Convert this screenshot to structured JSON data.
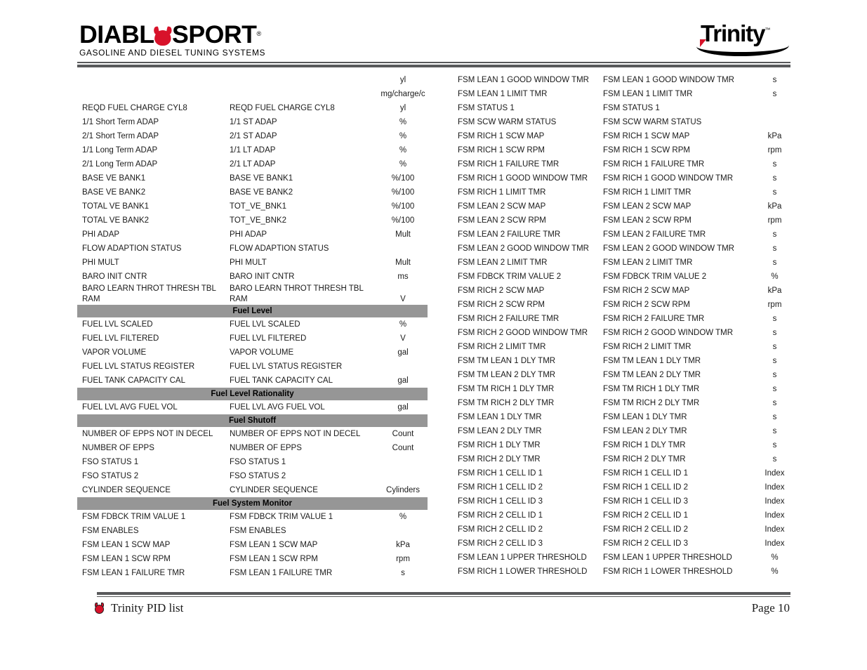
{
  "header": {
    "brand_logo": {
      "word_part1": "DIABL",
      "word_part2": "SPORT",
      "registered_mark": "®",
      "tagline": "GASOLINE AND DIESEL TUNING SYSTEMS",
      "devil_color": "#d8122a"
    },
    "product_logo": {
      "word": "Trinity",
      "tm_mark": "™",
      "accent_color": "#d8122a"
    },
    "rule_color": "#58595b"
  },
  "section_bar_color": "#969696",
  "left_column": {
    "leading_units": [
      "yl",
      "mg/charge/c"
    ],
    "rows": [
      {
        "type": "data",
        "name": "REQD FUEL CHARGE CYL8",
        "abbr": "REQD FUEL CHARGE CYL8",
        "unit": "yl"
      },
      {
        "type": "data",
        "name": "1/1 Short Term ADAP",
        "abbr": "1/1 ST ADAP",
        "unit": "%"
      },
      {
        "type": "data",
        "name": "2/1 Short Term ADAP",
        "abbr": "2/1 ST ADAP",
        "unit": "%"
      },
      {
        "type": "data",
        "name": "1/1 Long Term ADAP",
        "abbr": "1/1 LT ADAP",
        "unit": "%"
      },
      {
        "type": "data",
        "name": "2/1 Long Term ADAP",
        "abbr": "2/1 LT ADAP",
        "unit": "%"
      },
      {
        "type": "data",
        "name": "BASE VE BANK1",
        "abbr": "BASE VE BANK1",
        "unit": "%/100"
      },
      {
        "type": "data",
        "name": "BASE VE BANK2",
        "abbr": "BASE VE BANK2",
        "unit": "%/100"
      },
      {
        "type": "data",
        "name": "TOTAL VE BANK1",
        "abbr": "TOT_VE_BNK1",
        "unit": "%/100"
      },
      {
        "type": "data",
        "name": "TOTAL VE BANK2",
        "abbr": "TOT_VE_BNK2",
        "unit": "%/100"
      },
      {
        "type": "data",
        "name": "PHI ADAP",
        "abbr": "PHI ADAP",
        "unit": "Mult"
      },
      {
        "type": "data",
        "name": "FLOW ADAPTION STATUS",
        "abbr": "FLOW ADAPTION STATUS",
        "unit": ""
      },
      {
        "type": "data",
        "name": "PHI MULT",
        "abbr": "PHI MULT",
        "unit": "Mult"
      },
      {
        "type": "data",
        "name": "BARO INIT CNTR",
        "abbr": "BARO INIT CNTR",
        "unit": "ms"
      },
      {
        "type": "wrap",
        "name_l1": "BARO LEARN THROT THRESH TBL",
        "name_l2": "RAM",
        "abbr_l1": "BARO LEARN THROT THRESH TBL",
        "abbr_l2": "RAM",
        "unit": "V"
      },
      {
        "type": "section",
        "label": "Fuel Level"
      },
      {
        "type": "data",
        "name": "FUEL LVL SCALED",
        "abbr": "FUEL LVL SCALED",
        "unit": "%"
      },
      {
        "type": "data",
        "name": "FUEL LVL FILTERED",
        "abbr": "FUEL LVL FILTERED",
        "unit": "V"
      },
      {
        "type": "data",
        "name": "VAPOR VOLUME",
        "abbr": "VAPOR VOLUME",
        "unit": "gal"
      },
      {
        "type": "data",
        "name": "FUEL LVL STATUS REGISTER",
        "abbr": "FUEL LVL STATUS REGISTER",
        "unit": ""
      },
      {
        "type": "data",
        "name": "FUEL TANK CAPACITY CAL",
        "abbr": "FUEL TANK CAPACITY CAL",
        "unit": "gal"
      },
      {
        "type": "section",
        "label": "Fuel Level Rationality"
      },
      {
        "type": "data",
        "name": "FUEL LVL AVG FUEL VOL",
        "abbr": "FUEL LVL AVG FUEL VOL",
        "unit": "gal"
      },
      {
        "type": "section",
        "label": "Fuel Shutoff"
      },
      {
        "type": "data",
        "name": "NUMBER OF EPPS NOT IN DECEL",
        "abbr": "NUMBER OF EPPS NOT IN DECEL",
        "unit": "Count"
      },
      {
        "type": "data",
        "name": "NUMBER OF EPPS",
        "abbr": "NUMBER OF EPPS",
        "unit": "Count"
      },
      {
        "type": "data",
        "name": "FSO STATUS 1",
        "abbr": "FSO STATUS 1",
        "unit": ""
      },
      {
        "type": "data",
        "name": "FSO STATUS 2",
        "abbr": "FSO STATUS 2",
        "unit": ""
      },
      {
        "type": "data",
        "name": "CYLINDER SEQUENCE",
        "abbr": "CYLINDER SEQUENCE",
        "unit": "Cylinders"
      },
      {
        "type": "section",
        "label": "Fuel System Monitor"
      },
      {
        "type": "data",
        "name": "FSM FDBCK TRIM VALUE 1",
        "abbr": "FSM FDBCK TRIM VALUE 1",
        "unit": "%"
      },
      {
        "type": "data",
        "name": "FSM ENABLES",
        "abbr": "FSM ENABLES",
        "unit": ""
      },
      {
        "type": "data",
        "name": "FSM LEAN 1 SCW MAP",
        "abbr": "FSM LEAN 1 SCW MAP",
        "unit": "kPa"
      },
      {
        "type": "data",
        "name": "FSM LEAN 1 SCW RPM",
        "abbr": "FSM LEAN 1 SCW RPM",
        "unit": "rpm"
      },
      {
        "type": "data",
        "name": "FSM LEAN 1 FAILURE TMR",
        "abbr": "FSM LEAN 1 FAILURE TMR",
        "unit": "s"
      }
    ]
  },
  "right_column": {
    "rows": [
      {
        "type": "data",
        "name": "FSM LEAN 1 GOOD WINDOW TMR",
        "abbr": "FSM LEAN 1 GOOD WINDOW TMR",
        "unit": "s"
      },
      {
        "type": "data",
        "name": "FSM LEAN 1 LIMIT TMR",
        "abbr": "FSM LEAN 1 LIMIT TMR",
        "unit": "s"
      },
      {
        "type": "data",
        "name": "FSM STATUS 1",
        "abbr": "FSM STATUS 1",
        "unit": ""
      },
      {
        "type": "data",
        "name": "FSM SCW WARM STATUS",
        "abbr": "FSM SCW WARM STATUS",
        "unit": ""
      },
      {
        "type": "data",
        "name": "FSM RICH 1 SCW MAP",
        "abbr": "FSM RICH 1 SCW MAP",
        "unit": "kPa"
      },
      {
        "type": "data",
        "name": "FSM RICH 1 SCW RPM",
        "abbr": "FSM RICH 1 SCW RPM",
        "unit": "rpm"
      },
      {
        "type": "data",
        "name": "FSM RICH 1 FAILURE TMR",
        "abbr": "FSM RICH 1 FAILURE TMR",
        "unit": "s"
      },
      {
        "type": "data",
        "name": "FSM RICH 1 GOOD WINDOW TMR",
        "abbr": "FSM RICH 1 GOOD WINDOW TMR",
        "unit": "s"
      },
      {
        "type": "data",
        "name": "FSM RICH 1 LIMIT TMR",
        "abbr": "FSM RICH 1 LIMIT TMR",
        "unit": "s"
      },
      {
        "type": "data",
        "name": "FSM LEAN 2 SCW MAP",
        "abbr": "FSM LEAN 2 SCW MAP",
        "unit": "kPa"
      },
      {
        "type": "data",
        "name": "FSM LEAN 2 SCW RPM",
        "abbr": "FSM LEAN 2 SCW RPM",
        "unit": "rpm"
      },
      {
        "type": "data",
        "name": "FSM LEAN 2 FAILURE TMR",
        "abbr": "FSM LEAN 2 FAILURE TMR",
        "unit": "s"
      },
      {
        "type": "data",
        "name": "FSM LEAN 2 GOOD WINDOW TMR",
        "abbr": "FSM LEAN 2 GOOD WINDOW TMR",
        "unit": "s"
      },
      {
        "type": "data",
        "name": "FSM LEAN 2 LIMIT TMR",
        "abbr": "FSM LEAN 2 LIMIT TMR",
        "unit": "s"
      },
      {
        "type": "data",
        "name": "FSM FDBCK TRIM VALUE 2",
        "abbr": "FSM FDBCK TRIM VALUE 2",
        "unit": "%"
      },
      {
        "type": "data",
        "name": "FSM RICH 2 SCW MAP",
        "abbr": "FSM RICH 2 SCW MAP",
        "unit": "kPa"
      },
      {
        "type": "data",
        "name": "FSM RICH 2 SCW RPM",
        "abbr": "FSM RICH 2 SCW RPM",
        "unit": "rpm"
      },
      {
        "type": "data",
        "name": "FSM RICH 2 FAILURE TMR",
        "abbr": "FSM RICH 2 FAILURE TMR",
        "unit": "s"
      },
      {
        "type": "data",
        "name": "FSM RICH 2 GOOD WINDOW TMR",
        "abbr": "FSM RICH 2 GOOD WINDOW TMR",
        "unit": "s"
      },
      {
        "type": "data",
        "name": "FSM RICH 2 LIMIT TMR",
        "abbr": "FSM RICH 2 LIMIT TMR",
        "unit": "s"
      },
      {
        "type": "data",
        "name": "FSM TM LEAN 1 DLY TMR",
        "abbr": "FSM TM LEAN 1 DLY TMR",
        "unit": "s"
      },
      {
        "type": "data",
        "name": "FSM TM LEAN 2 DLY TMR",
        "abbr": "FSM TM LEAN 2 DLY TMR",
        "unit": "s"
      },
      {
        "type": "data",
        "name": "FSM TM RICH 1 DLY TMR",
        "abbr": "FSM TM RICH 1 DLY TMR",
        "unit": "s"
      },
      {
        "type": "data",
        "name": "FSM TM RICH 2 DLY TMR",
        "abbr": "FSM TM RICH 2 DLY TMR",
        "unit": "s"
      },
      {
        "type": "data",
        "name": "FSM LEAN 1 DLY TMR",
        "abbr": "FSM LEAN 1 DLY TMR",
        "unit": "s"
      },
      {
        "type": "data",
        "name": "FSM LEAN 2 DLY TMR",
        "abbr": "FSM LEAN 2 DLY TMR",
        "unit": "s"
      },
      {
        "type": "data",
        "name": "FSM RICH 1 DLY TMR",
        "abbr": "FSM RICH 1 DLY TMR",
        "unit": "s"
      },
      {
        "type": "data",
        "name": "FSM RICH 2 DLY TMR",
        "abbr": "FSM RICH 2 DLY TMR",
        "unit": "s"
      },
      {
        "type": "data",
        "name": "FSM RICH 1 CELL ID 1",
        "abbr": "FSM RICH 1 CELL ID 1",
        "unit": "Index"
      },
      {
        "type": "data",
        "name": "FSM RICH 1 CELL ID 2",
        "abbr": "FSM RICH 1 CELL ID 2",
        "unit": "Index"
      },
      {
        "type": "data",
        "name": "FSM RICH 1 CELL ID 3",
        "abbr": "FSM RICH 1 CELL ID 3",
        "unit": "Index"
      },
      {
        "type": "data",
        "name": "FSM RICH 2 CELL ID 1",
        "abbr": "FSM RICH 2 CELL ID 1",
        "unit": "Index"
      },
      {
        "type": "data",
        "name": "FSM RICH 2 CELL ID 2",
        "abbr": "FSM RICH 2 CELL ID 2",
        "unit": "Index"
      },
      {
        "type": "data",
        "name": "FSM RICH 2 CELL ID 3",
        "abbr": "FSM RICH 2 CELL ID 3",
        "unit": "Index"
      },
      {
        "type": "data",
        "name": "FSM LEAN 1 UPPER THRESHOLD",
        "abbr": "FSM LEAN 1 UPPER THRESHOLD",
        "unit": "%"
      },
      {
        "type": "data",
        "name": "FSM RICH 1 LOWER THRESHOLD",
        "abbr": "FSM RICH 1 LOWER THRESHOLD",
        "unit": "%"
      }
    ]
  },
  "footer": {
    "title": "Trinity PID list",
    "page_label": "Page 10"
  }
}
